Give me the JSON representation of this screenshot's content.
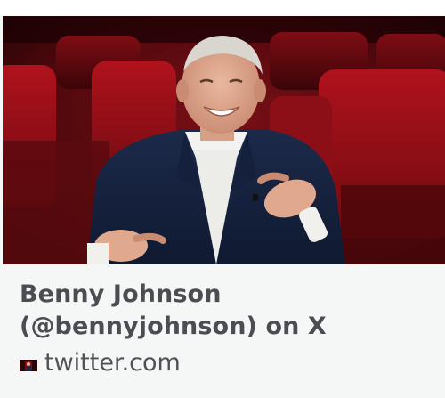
{
  "link_card": {
    "title": "Benny Johnson (@bennyjohnson) on X",
    "domain": "twitter.com",
    "image": {
      "icon": "person-in-theater-photo"
    },
    "favicon_icon": "site-favicon-icon",
    "colors": {
      "card_background": "#f5f6f6",
      "title_text": "#4a4d52",
      "domain_text": "#4f5358",
      "image_dominant": "#8a0d14"
    }
  }
}
